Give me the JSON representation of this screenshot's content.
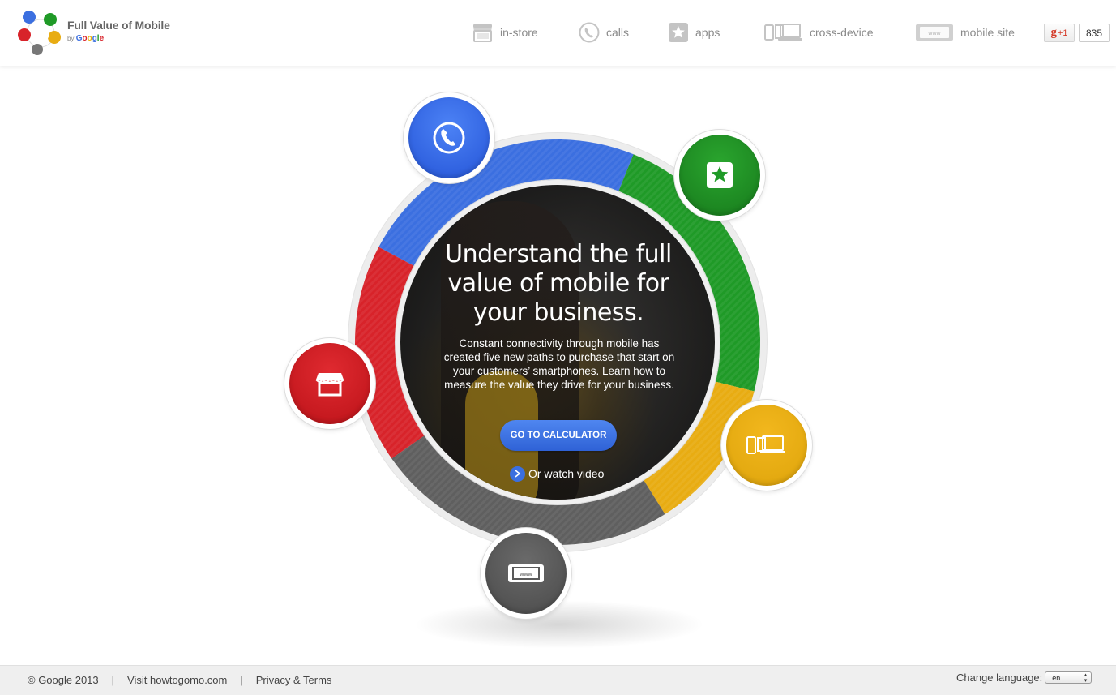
{
  "brand": {
    "title": "Full Value of Mobile",
    "by": "by",
    "google": [
      "G",
      "o",
      "o",
      "g",
      "l",
      "e"
    ]
  },
  "nav": {
    "instore": "in-store",
    "calls": "calls",
    "apps": "apps",
    "cross_device": "cross-device",
    "mobile_site": "mobile site"
  },
  "gplus": {
    "g": "g",
    "plus_one": "+1",
    "count": "835"
  },
  "hero": {
    "title": "Understand the full value of mobile for your business.",
    "description": "Constant connectivity through mobile has created five new paths to purchase that start on your customers’ smartphones. Learn how to measure the value they drive for your business.",
    "cta": "GO TO CALCULATOR",
    "watch": "Or watch video"
  },
  "icons": {
    "www_text": "www"
  },
  "colors": {
    "blue": "#3b6fe0",
    "green": "#1f9a27",
    "yellow": "#e8ac12",
    "red": "#d8232a",
    "gray": "#5f5f5f"
  },
  "footer": {
    "copyright": "© Google 2013",
    "sep": "|",
    "visit": "Visit howtogomo.com",
    "privacy": "Privacy & Terms",
    "change_language": "Change language:",
    "language_value": "en"
  }
}
